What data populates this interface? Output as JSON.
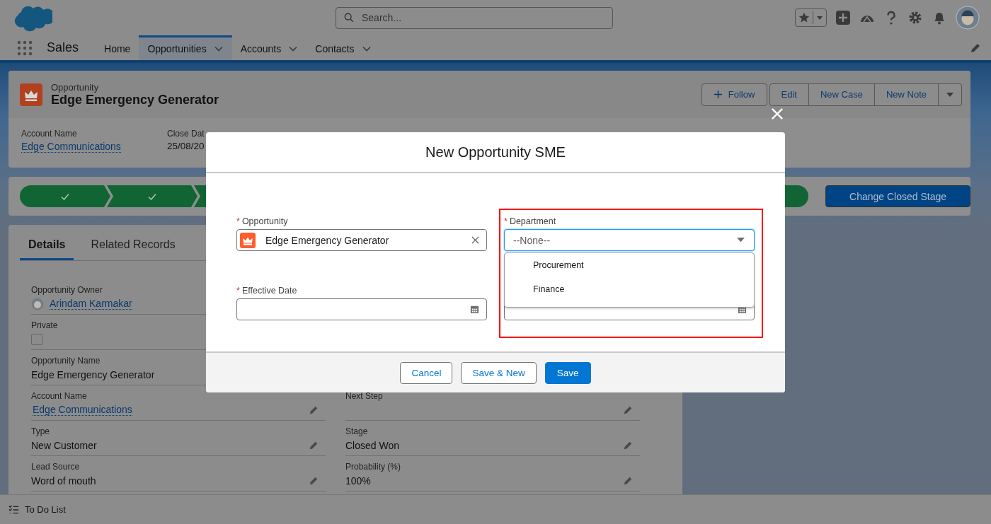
{
  "global_header": {
    "search": {
      "placeholder": "Search..."
    }
  },
  "nav": {
    "app_name": "Sales",
    "tabs": [
      {
        "label": "Home",
        "selected": false,
        "menu": false
      },
      {
        "label": "Opportunities",
        "selected": true,
        "menu": true
      },
      {
        "label": "Accounts",
        "selected": false,
        "menu": true
      },
      {
        "label": "Contacts",
        "selected": false,
        "menu": true
      }
    ]
  },
  "record": {
    "object_type": "Opportunity",
    "title": "Edge Emergency Generator",
    "actions": [
      {
        "label": "Follow",
        "kind": "follow"
      },
      {
        "label": "Edit",
        "kind": "group"
      },
      {
        "label": "New Case",
        "kind": "group"
      },
      {
        "label": "New Note",
        "kind": "group"
      }
    ],
    "highlights": [
      {
        "label": "Account Name",
        "value": "Edge Communications",
        "link": true
      },
      {
        "label": "Close Dat",
        "value": "25/08/20",
        "link": false
      }
    ]
  },
  "path": {
    "stages": [
      {
        "complete": true
      },
      {
        "complete": true
      }
    ],
    "button": "Change Closed Stage"
  },
  "details": {
    "tabs": [
      {
        "label": "Details",
        "selected": true
      },
      {
        "label": "Related Records",
        "selected": false
      }
    ],
    "left_fields": [
      {
        "label": "Opportunity Owner",
        "value": "Arindam Karmakar",
        "kind": "user"
      },
      {
        "label": "Private",
        "kind": "checkbox",
        "checked": false
      },
      {
        "label": "Opportunity Name",
        "value": "Edge Emergency Generator",
        "kind": "text"
      },
      {
        "label": "Account Name",
        "value": "Edge Communications",
        "kind": "link",
        "editable": true
      },
      {
        "label": "Type",
        "value": "New Customer",
        "kind": "text",
        "editable": true
      },
      {
        "label": "Lead Source",
        "value": "Word of mouth",
        "kind": "text",
        "editable": true
      }
    ],
    "right_fields": [
      {
        "label": "Next Step",
        "kind": "text",
        "editable": true
      },
      {
        "label": "Stage",
        "value": "Closed Won",
        "kind": "text",
        "editable": true
      },
      {
        "label": "Probability (%)",
        "value": "100%",
        "kind": "text",
        "editable": true
      }
    ]
  },
  "modal": {
    "title": "New Opportunity SME",
    "fields": [
      {
        "label": "Opportunity",
        "required_mark": "*",
        "kind": "lookup",
        "value": "Edge Emergency Generator"
      },
      {
        "label": "Effective Date",
        "required_mark": "*",
        "kind": "date"
      },
      {
        "label": "Department",
        "required_mark": "*",
        "kind": "picklist",
        "value": "--None--",
        "open": true,
        "options": [
          "Procurement",
          "Finance"
        ]
      },
      {
        "kind": "date"
      }
    ],
    "buttons": [
      {
        "label": "Cancel",
        "kind": "neutral"
      },
      {
        "label": "Save & New",
        "kind": "neutral"
      },
      {
        "label": "Save",
        "kind": "brand"
      }
    ]
  },
  "utility_bar": {
    "label": "To Do List"
  }
}
